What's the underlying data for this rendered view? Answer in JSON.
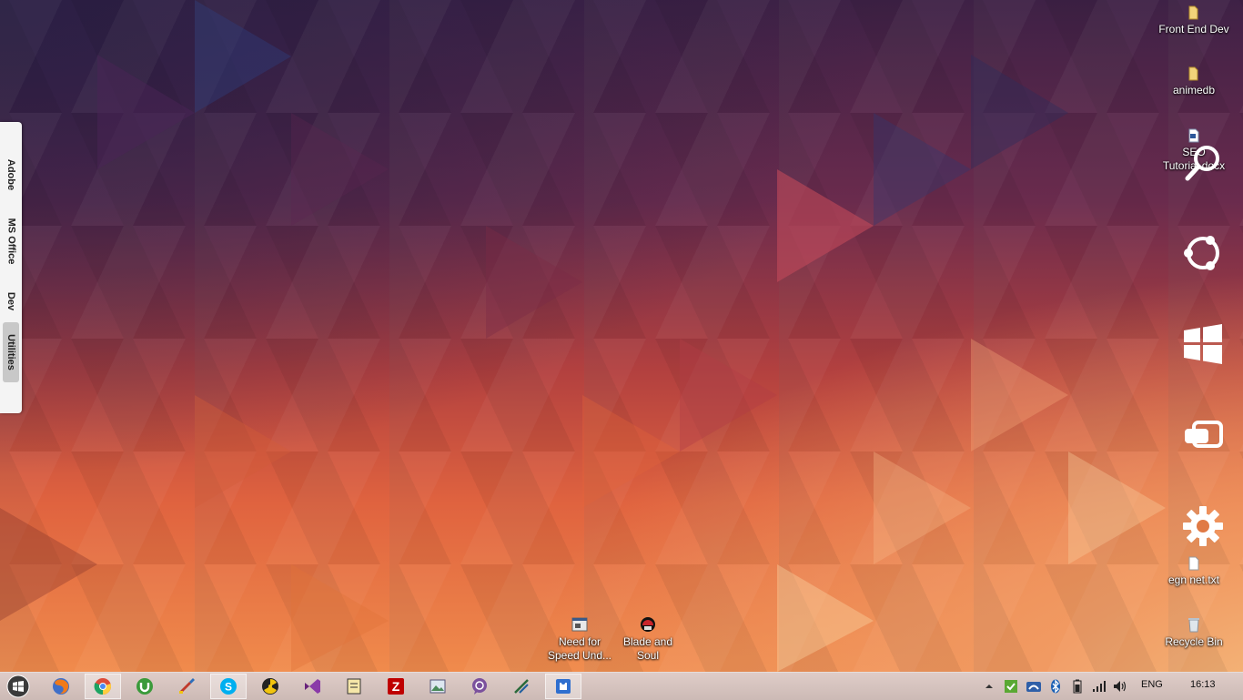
{
  "side_dock": {
    "tabs": [
      {
        "label": "Adobe"
      },
      {
        "label": "MS Office"
      },
      {
        "label": "Dev"
      },
      {
        "label": "Utilities"
      }
    ]
  },
  "desktop_icons": {
    "front_end_dev": {
      "label": "Front End Dev",
      "icon": "folder-icon"
    },
    "animedb": {
      "label": "animedb",
      "icon": "folder-icon"
    },
    "seo_tutorial": {
      "label": "SEO Tutorial.docx",
      "icon": "word-document-icon"
    },
    "egn_net": {
      "label": "egn net.txt",
      "icon": "text-file-icon"
    },
    "recycle_bin": {
      "label": "Recycle Bin",
      "icon": "recycle-bin-icon"
    },
    "need_for_speed": {
      "label": "Need for Speed Und...",
      "icon": "game-shortcut-icon"
    },
    "blade_and_soul": {
      "label": "Blade and Soul",
      "icon": "game-shortcut-icon"
    }
  },
  "charms": [
    "search-icon",
    "share-icon",
    "start-windows-icon",
    "devices-icon",
    "settings-gear-icon"
  ],
  "taskbar": {
    "pinned": [
      {
        "name": "start-button",
        "icon": "windows-orb-icon"
      },
      {
        "name": "firefox",
        "icon": "firefox-icon"
      },
      {
        "name": "chrome",
        "icon": "chrome-icon",
        "active": true
      },
      {
        "name": "utorrent",
        "icon": "utorrent-icon"
      },
      {
        "name": "paint-brush",
        "icon": "paint-brush-icon"
      },
      {
        "name": "skype",
        "icon": "skype-icon",
        "active": true
      },
      {
        "name": "radiation-app",
        "icon": "radiation-icon"
      },
      {
        "name": "visual-studio",
        "icon": "visual-studio-icon"
      },
      {
        "name": "notes",
        "icon": "notes-icon"
      },
      {
        "name": "filezilla",
        "icon": "filezilla-icon"
      },
      {
        "name": "photo-viewer",
        "icon": "photo-icon"
      },
      {
        "name": "viber",
        "icon": "viber-icon"
      },
      {
        "name": "snipping",
        "icon": "snipping-icon"
      },
      {
        "name": "puzzle-app",
        "icon": "puzzle-icon",
        "active": true
      }
    ],
    "tray": {
      "language": "ENG",
      "time": "16:13"
    }
  },
  "colors": {
    "taskbar": "#d4c0bb",
    "dock_bg": "#f4f4f4",
    "wallpaper_top": "#3e2146",
    "wallpaper_bottom": "#f08b4c"
  }
}
